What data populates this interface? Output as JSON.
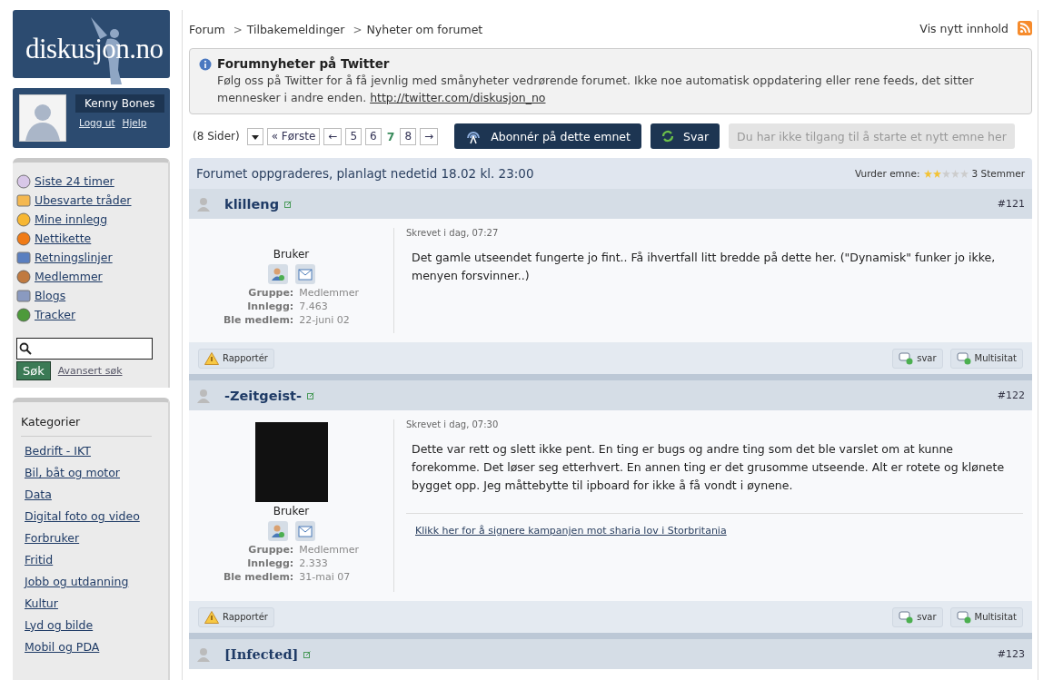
{
  "logo": {
    "text": "diskusjon.no"
  },
  "user": {
    "name": "Kenny Bones",
    "links": [
      "Logg ut",
      "Hjelp"
    ]
  },
  "nav": [
    "Siste 24 timer",
    "Ubesvarte tråder",
    "Mine innlegg",
    "Nettikette",
    "Retningslinjer",
    "Medlemmer",
    "Blogs",
    "Tracker"
  ],
  "search": {
    "button": "Søk",
    "advanced": "Avansert søk"
  },
  "categories": {
    "title": "Kategorier",
    "items": [
      "Bedrift - IKT",
      "Bil, båt og motor",
      "Data",
      "Digital foto og video",
      "Forbruker",
      "Fritid",
      "Jobb og utdanning",
      "Kultur",
      "Lyd og bilde",
      "Mobil og PDA"
    ]
  },
  "breadcrumb": [
    "Forum",
    "Tilbakemeldinger",
    "Nyheter om forumet"
  ],
  "breadcrumb_separators": [
    ">",
    ">"
  ],
  "new_content": "Vis nytt innhold",
  "notice": {
    "title": "Forumnyheter på Twitter",
    "text": "Følg oss på Twitter for å få jevnlig med smånyheter vedrørende forumet. Ikke noe automatisk oppdatering eller rene feeds, det sitter mennesker i andre enden.",
    "link": "http://twitter.com/diskusjon_no"
  },
  "pagination": {
    "count": "(8 Sider)",
    "first": "« Første",
    "prev": "←",
    "next": "→",
    "pages": [
      {
        "label": "5",
        "selected": false
      },
      {
        "label": "6",
        "selected": false
      },
      {
        "label": "7",
        "selected": true
      },
      {
        "label": "8",
        "selected": false
      }
    ]
  },
  "actions": {
    "subscribe": "Abonnér på dette emnet",
    "reply": "Svar",
    "new_topic": "Du har ikke tilgang til å starte et nytt emne her"
  },
  "topic": {
    "title": "Forumet oppgraderes, planlagt nedetid 18.02 kl. 23:00",
    "rate_label": "Vurder emne:",
    "stars": 2,
    "votes": "3 Stemmer"
  },
  "posts": [
    {
      "author": "klilleng",
      "number": "#121",
      "date": "Skrevet i dag, 07:27",
      "photo": false,
      "role": "Bruker",
      "fields": [
        [
          "Gruppe:",
          "Medlemmer"
        ],
        [
          "Innlegg:",
          "7.463"
        ],
        [
          "Ble medlem:",
          "22-juni 02"
        ]
      ],
      "body": "Det gamle utseendet fungerte jo fint.. Få ihvertfall litt bredde på dette her. (\"Dynamisk\" funker jo ikke, menyen forsvinner..)",
      "report": "Rapportér",
      "reply": "svar",
      "multiquote": "Multisitat"
    },
    {
      "author": "-Zeitgeist-",
      "number": "#122",
      "date": "Skrevet i dag, 07:30",
      "photo": true,
      "role": "Bruker",
      "fields": [
        [
          "Gruppe:",
          "Medlemmer"
        ],
        [
          "Innlegg:",
          "2.333"
        ],
        [
          "Ble medlem:",
          "31-mai 07"
        ]
      ],
      "body": "Dette var rett og slett ikke pent. En ting er bugs og andre ting som det ble varslet om at kunne forekomme. Det løser seg etterhvert. En annen ting er det grusomme utseende. Alt er rotete og klønete bygget opp. Jeg måttebytte til ipboard for ikke å få vondt i øynene.",
      "signature": "Klikk her for å signere kampanjen mot sharia lov i Storbritania",
      "report": "Rapportér",
      "reply": "svar",
      "multiquote": "Multisitat"
    },
    {
      "author": "[Infected]",
      "number": "#123",
      "serif": true
    }
  ]
}
